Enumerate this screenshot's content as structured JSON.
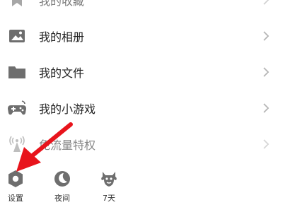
{
  "menu": {
    "items": [
      {
        "label": "我的收藏",
        "icon": "bookmark-icon"
      },
      {
        "label": "我的相册",
        "icon": "image-icon"
      },
      {
        "label": "我的文件",
        "icon": "folder-icon"
      },
      {
        "label": "我的小游戏",
        "icon": "gamepad-icon"
      },
      {
        "label": "免流量特权",
        "icon": "signal-tower-icon"
      }
    ]
  },
  "bottom_bar": {
    "items": [
      {
        "label": "设置",
        "icon": "settings-icon"
      },
      {
        "label": "夜间",
        "icon": "moon-icon"
      },
      {
        "label": "7天",
        "icon": "mascot-icon"
      }
    ]
  },
  "colors": {
    "icon_gray": "#6e6e6e",
    "annotation_arrow": "#e8141c",
    "chevron": "#b5b5b5"
  }
}
